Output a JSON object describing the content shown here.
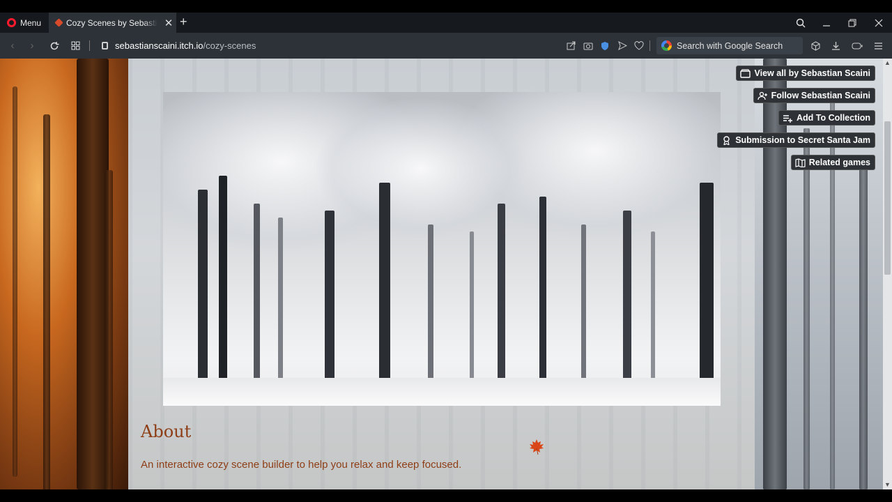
{
  "browser": {
    "menu_label": "Menu",
    "tab_title": "Cozy Scenes by Sebastian Scaini",
    "url_host": "sebastianscaini.itch.io",
    "url_path": "/cozy-scenes",
    "search_placeholder": "Search with Google Search"
  },
  "sidebar_buttons": {
    "view_all": "View all by Sebastian Scaini",
    "follow": "Follow Sebastian Scaini",
    "add_collection": "Add To Collection",
    "submission": "Submission to Secret Santa Jam",
    "related": "Related games"
  },
  "main": {
    "about_title": "About",
    "about_text": "An interactive cozy scene builder to help you relax and keep focused."
  },
  "colors": {
    "text_accent": "#8e3e16",
    "button_bg": "#2e3236"
  }
}
